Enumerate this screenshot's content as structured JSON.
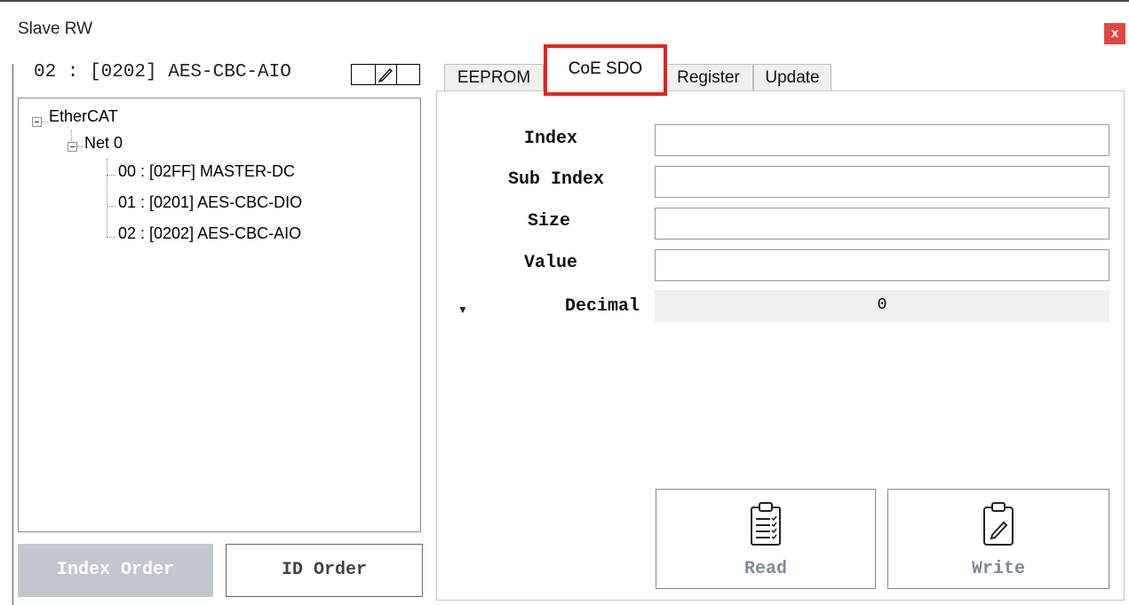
{
  "window": {
    "title": "Slave RW",
    "close_label": "x"
  },
  "header": {
    "selected_slave": "02 : [0202] AES-CBC-AIO"
  },
  "tree": {
    "root": "EtherCAT",
    "net": "Net 0",
    "items": [
      "00 : [02FF] MASTER-DC",
      "01 : [0201] AES-CBC-DIO",
      "02 : [0202] AES-CBC-AIO"
    ]
  },
  "order_buttons": {
    "index_order": "Index Order",
    "id_order": "ID Order"
  },
  "tabs": [
    {
      "label": "EEPROM"
    },
    {
      "label": "CoE SDO"
    },
    {
      "label": "Register"
    },
    {
      "label": "Update"
    }
  ],
  "active_tab": "CoE SDO",
  "form": {
    "index_label": "Index",
    "sub_index_label": "Sub Index",
    "size_label": "Size",
    "value_label": "Value",
    "index_value": "",
    "sub_index_value": "",
    "size_value": "",
    "value_value": "",
    "format_label": "Decimal",
    "format_result": "0"
  },
  "actions": {
    "read_label": "Read",
    "write_label": "Write"
  },
  "colors": {
    "close_button": "#e0483f",
    "tab_highlight": "#e8211c",
    "disabled_button": "#c2c7cf",
    "action_accent": "#7d8a99"
  }
}
